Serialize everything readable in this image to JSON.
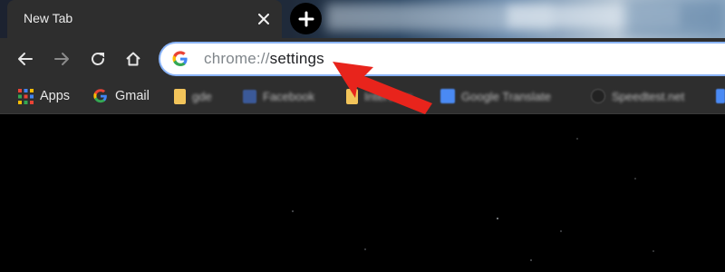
{
  "tab": {
    "title": "New Tab"
  },
  "toolbar": {
    "omnibox": {
      "scheme": "chrome://",
      "path": "settings"
    }
  },
  "bookmarks": {
    "items": [
      {
        "label": "Apps",
        "icon": "apps-grid-icon"
      },
      {
        "label": "Gmail",
        "icon": "google-g-icon"
      },
      {
        "label": "gde",
        "icon": "folder-icon"
      },
      {
        "label": "Facebook",
        "icon": "facebook-icon"
      },
      {
        "label": "Interview",
        "icon": "folder-icon"
      },
      {
        "label": "Google Translate",
        "icon": "google-translate-icon"
      },
      {
        "label": "Speedtest.net",
        "icon": "speedtest-icon"
      }
    ]
  },
  "annotation": {
    "arrow_color": "#e8241c"
  },
  "colors": {
    "toolbar": "#2e2e2e",
    "omnibox_focus": "#8ab4f8"
  }
}
